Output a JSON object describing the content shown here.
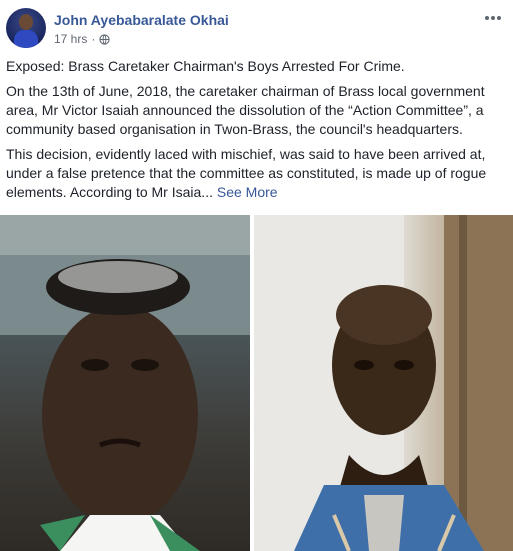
{
  "post": {
    "author": "John Ayebabaralate Okhai",
    "time": "17 hrs",
    "separator": "·",
    "headline": "Exposed: Brass Caretaker Chairman's Boys Arrested For Crime.",
    "paragraph1": "On the 13th of June, 2018, the caretaker chairman of Brass local government area, Mr Victor Isaiah announced the dissolution of the “Action Committee”, a community based organisation in Twon-Brass, the council's headquarters.",
    "paragraph2": "This decision, evidently laced with mischief, was said to have been arrived at, under a false pretence that the committee as constituted, is made up of rogue elements. According to Mr Isaia...",
    "see_more": "See More"
  },
  "icons": {
    "avatar": "avatar",
    "globe": "globe-icon",
    "more": "more-options-icon"
  },
  "colors": {
    "author_link": "#385898",
    "meta_text": "#616770",
    "body_text": "#1d2129"
  }
}
